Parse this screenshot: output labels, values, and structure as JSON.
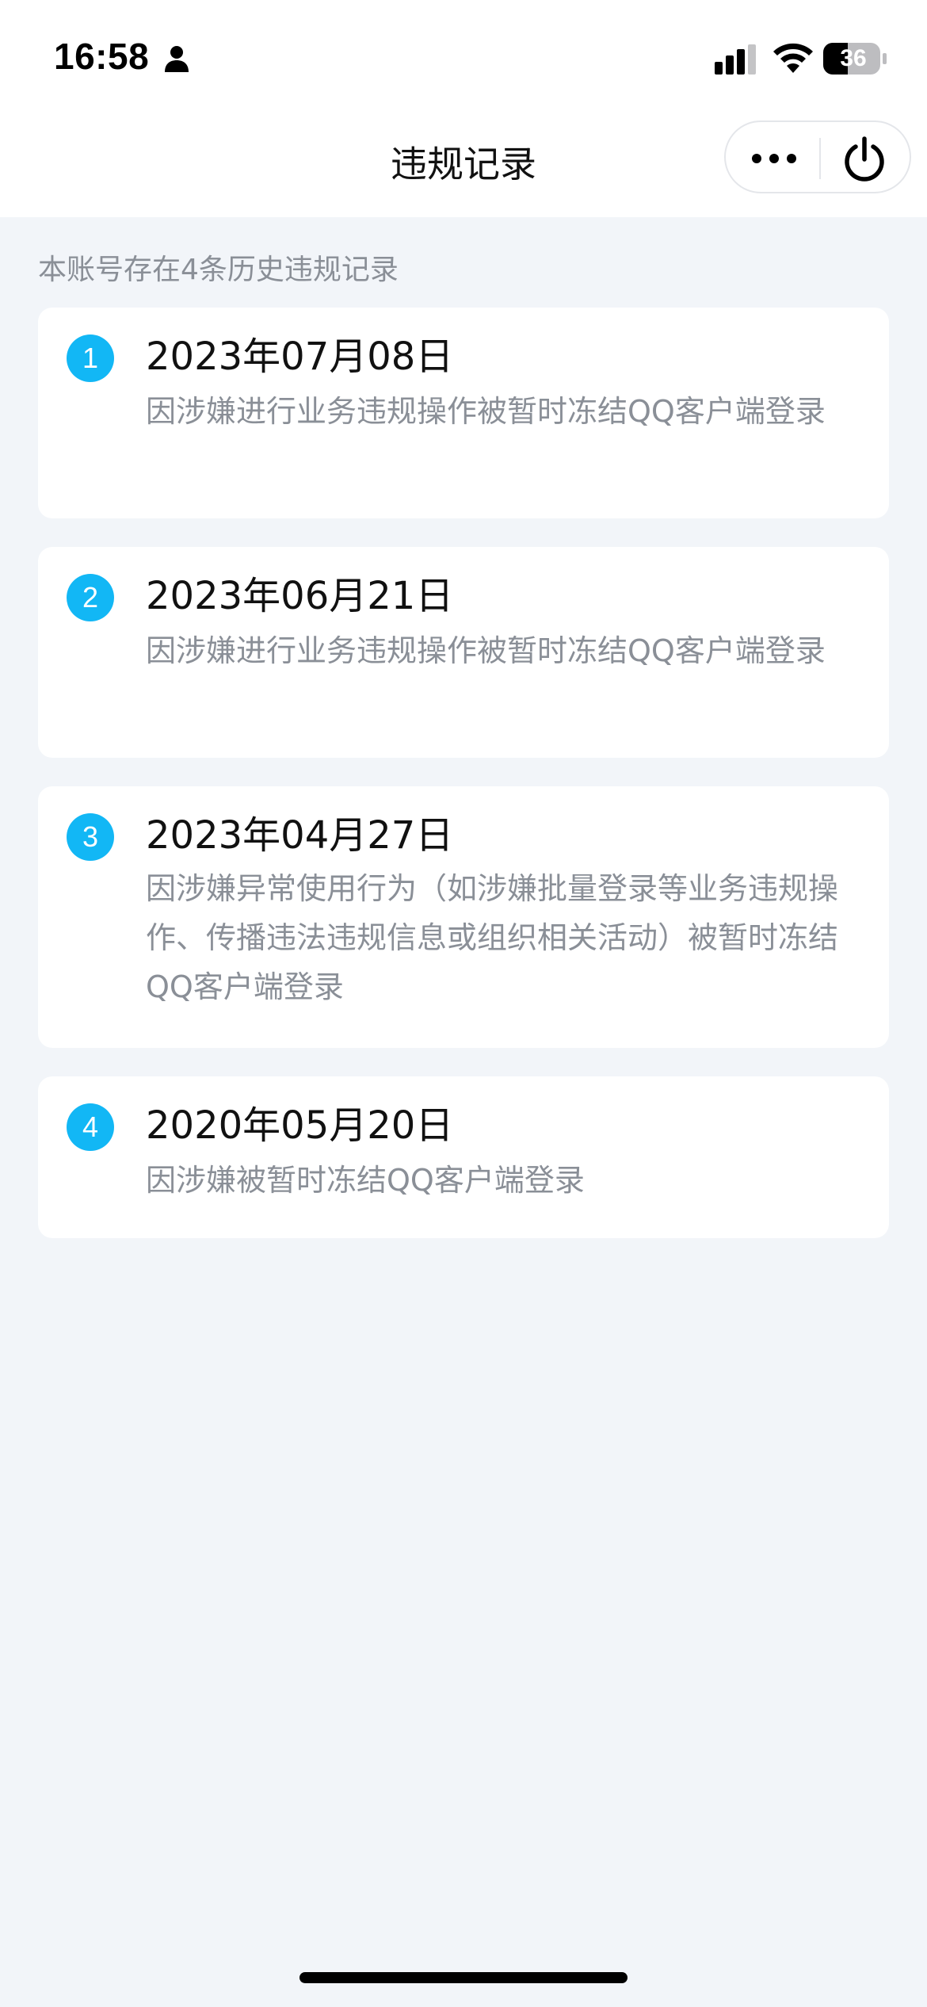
{
  "status_bar": {
    "time": "16:58",
    "battery": "36",
    "icons": [
      "person-icon",
      "signal-icon",
      "wifi-icon",
      "battery-icon"
    ]
  },
  "nav": {
    "title": "违规记录",
    "icons": [
      "more-icon",
      "power-icon"
    ]
  },
  "summary": "本账号存在4条历史违规记录",
  "records": [
    {
      "index": "1",
      "date": "2023年07月08日",
      "desc": "因涉嫌进行业务违规操作被暂时冻结QQ客户端登录"
    },
    {
      "index": "2",
      "date": "2023年06月21日",
      "desc": "因涉嫌进行业务违规操作被暂时冻结QQ客户端登录"
    },
    {
      "index": "3",
      "date": "2023年04月27日",
      "desc": "因涉嫌异常使用行为（如涉嫌批量登录等业务违规操作、传播违法违规信息或组织相关活动）被暂时冻结QQ客户端登录"
    },
    {
      "index": "4",
      "date": "2020年05月20日",
      "desc": "因涉嫌被暂时冻结QQ客户端登录"
    }
  ],
  "colors": {
    "background": "#f2f5f9",
    "card": "#ffffff",
    "badge": "#12b7f5",
    "text_primary": "#111111",
    "text_secondary": "#8a8f97"
  }
}
